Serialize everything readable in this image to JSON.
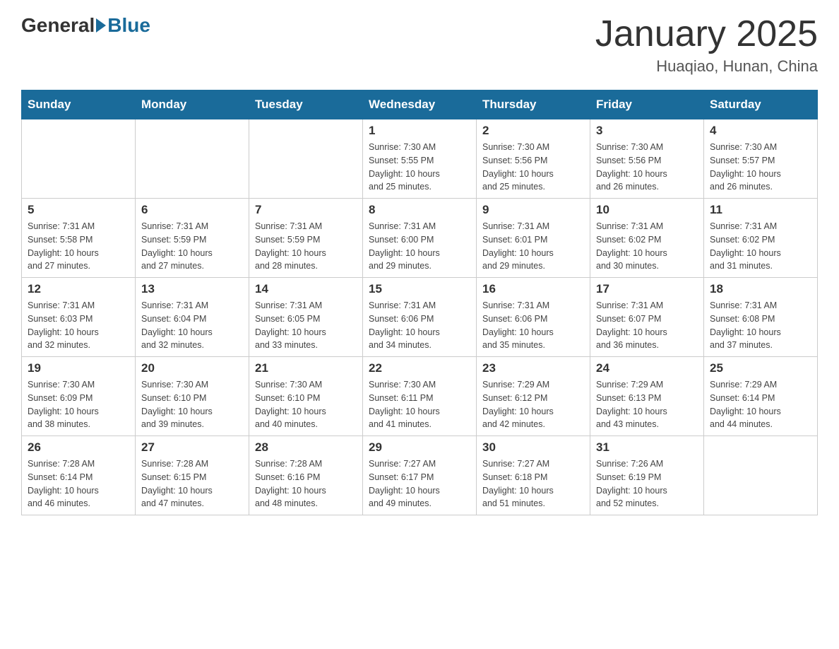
{
  "header": {
    "logo_general": "General",
    "logo_blue": "Blue",
    "month_title": "January 2025",
    "location": "Huaqiao, Hunan, China"
  },
  "days_of_week": [
    "Sunday",
    "Monday",
    "Tuesday",
    "Wednesday",
    "Thursday",
    "Friday",
    "Saturday"
  ],
  "weeks": [
    [
      {
        "day": "",
        "info": ""
      },
      {
        "day": "",
        "info": ""
      },
      {
        "day": "",
        "info": ""
      },
      {
        "day": "1",
        "info": "Sunrise: 7:30 AM\nSunset: 5:55 PM\nDaylight: 10 hours\nand 25 minutes."
      },
      {
        "day": "2",
        "info": "Sunrise: 7:30 AM\nSunset: 5:56 PM\nDaylight: 10 hours\nand 25 minutes."
      },
      {
        "day": "3",
        "info": "Sunrise: 7:30 AM\nSunset: 5:56 PM\nDaylight: 10 hours\nand 26 minutes."
      },
      {
        "day": "4",
        "info": "Sunrise: 7:30 AM\nSunset: 5:57 PM\nDaylight: 10 hours\nand 26 minutes."
      }
    ],
    [
      {
        "day": "5",
        "info": "Sunrise: 7:31 AM\nSunset: 5:58 PM\nDaylight: 10 hours\nand 27 minutes."
      },
      {
        "day": "6",
        "info": "Sunrise: 7:31 AM\nSunset: 5:59 PM\nDaylight: 10 hours\nand 27 minutes."
      },
      {
        "day": "7",
        "info": "Sunrise: 7:31 AM\nSunset: 5:59 PM\nDaylight: 10 hours\nand 28 minutes."
      },
      {
        "day": "8",
        "info": "Sunrise: 7:31 AM\nSunset: 6:00 PM\nDaylight: 10 hours\nand 29 minutes."
      },
      {
        "day": "9",
        "info": "Sunrise: 7:31 AM\nSunset: 6:01 PM\nDaylight: 10 hours\nand 29 minutes."
      },
      {
        "day": "10",
        "info": "Sunrise: 7:31 AM\nSunset: 6:02 PM\nDaylight: 10 hours\nand 30 minutes."
      },
      {
        "day": "11",
        "info": "Sunrise: 7:31 AM\nSunset: 6:02 PM\nDaylight: 10 hours\nand 31 minutes."
      }
    ],
    [
      {
        "day": "12",
        "info": "Sunrise: 7:31 AM\nSunset: 6:03 PM\nDaylight: 10 hours\nand 32 minutes."
      },
      {
        "day": "13",
        "info": "Sunrise: 7:31 AM\nSunset: 6:04 PM\nDaylight: 10 hours\nand 32 minutes."
      },
      {
        "day": "14",
        "info": "Sunrise: 7:31 AM\nSunset: 6:05 PM\nDaylight: 10 hours\nand 33 minutes."
      },
      {
        "day": "15",
        "info": "Sunrise: 7:31 AM\nSunset: 6:06 PM\nDaylight: 10 hours\nand 34 minutes."
      },
      {
        "day": "16",
        "info": "Sunrise: 7:31 AM\nSunset: 6:06 PM\nDaylight: 10 hours\nand 35 minutes."
      },
      {
        "day": "17",
        "info": "Sunrise: 7:31 AM\nSunset: 6:07 PM\nDaylight: 10 hours\nand 36 minutes."
      },
      {
        "day": "18",
        "info": "Sunrise: 7:31 AM\nSunset: 6:08 PM\nDaylight: 10 hours\nand 37 minutes."
      }
    ],
    [
      {
        "day": "19",
        "info": "Sunrise: 7:30 AM\nSunset: 6:09 PM\nDaylight: 10 hours\nand 38 minutes."
      },
      {
        "day": "20",
        "info": "Sunrise: 7:30 AM\nSunset: 6:10 PM\nDaylight: 10 hours\nand 39 minutes."
      },
      {
        "day": "21",
        "info": "Sunrise: 7:30 AM\nSunset: 6:10 PM\nDaylight: 10 hours\nand 40 minutes."
      },
      {
        "day": "22",
        "info": "Sunrise: 7:30 AM\nSunset: 6:11 PM\nDaylight: 10 hours\nand 41 minutes."
      },
      {
        "day": "23",
        "info": "Sunrise: 7:29 AM\nSunset: 6:12 PM\nDaylight: 10 hours\nand 42 minutes."
      },
      {
        "day": "24",
        "info": "Sunrise: 7:29 AM\nSunset: 6:13 PM\nDaylight: 10 hours\nand 43 minutes."
      },
      {
        "day": "25",
        "info": "Sunrise: 7:29 AM\nSunset: 6:14 PM\nDaylight: 10 hours\nand 44 minutes."
      }
    ],
    [
      {
        "day": "26",
        "info": "Sunrise: 7:28 AM\nSunset: 6:14 PM\nDaylight: 10 hours\nand 46 minutes."
      },
      {
        "day": "27",
        "info": "Sunrise: 7:28 AM\nSunset: 6:15 PM\nDaylight: 10 hours\nand 47 minutes."
      },
      {
        "day": "28",
        "info": "Sunrise: 7:28 AM\nSunset: 6:16 PM\nDaylight: 10 hours\nand 48 minutes."
      },
      {
        "day": "29",
        "info": "Sunrise: 7:27 AM\nSunset: 6:17 PM\nDaylight: 10 hours\nand 49 minutes."
      },
      {
        "day": "30",
        "info": "Sunrise: 7:27 AM\nSunset: 6:18 PM\nDaylight: 10 hours\nand 51 minutes."
      },
      {
        "day": "31",
        "info": "Sunrise: 7:26 AM\nSunset: 6:19 PM\nDaylight: 10 hours\nand 52 minutes."
      },
      {
        "day": "",
        "info": ""
      }
    ]
  ]
}
